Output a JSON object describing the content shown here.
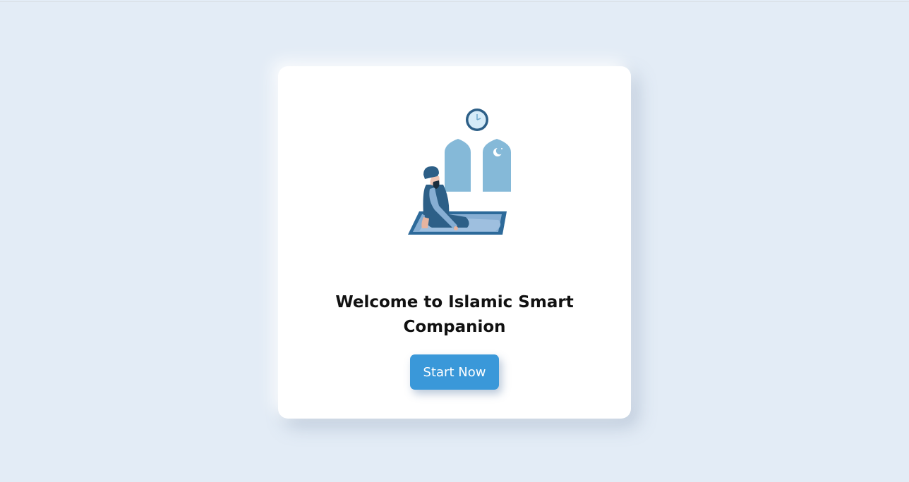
{
  "welcome": {
    "title_line1": "Welcome to Islamic Smart",
    "title_line2": "Companion"
  },
  "actions": {
    "start_label": "Start Now"
  },
  "colors": {
    "background": "#e3ecf6",
    "card": "#ffffff",
    "accent": "#3a98d9",
    "illustration_dark": "#2d5f87",
    "illustration_light": "#85b9d8"
  },
  "icons": {
    "illustration": "person-praying-on-mat-with-mosque-windows-and-clock"
  }
}
